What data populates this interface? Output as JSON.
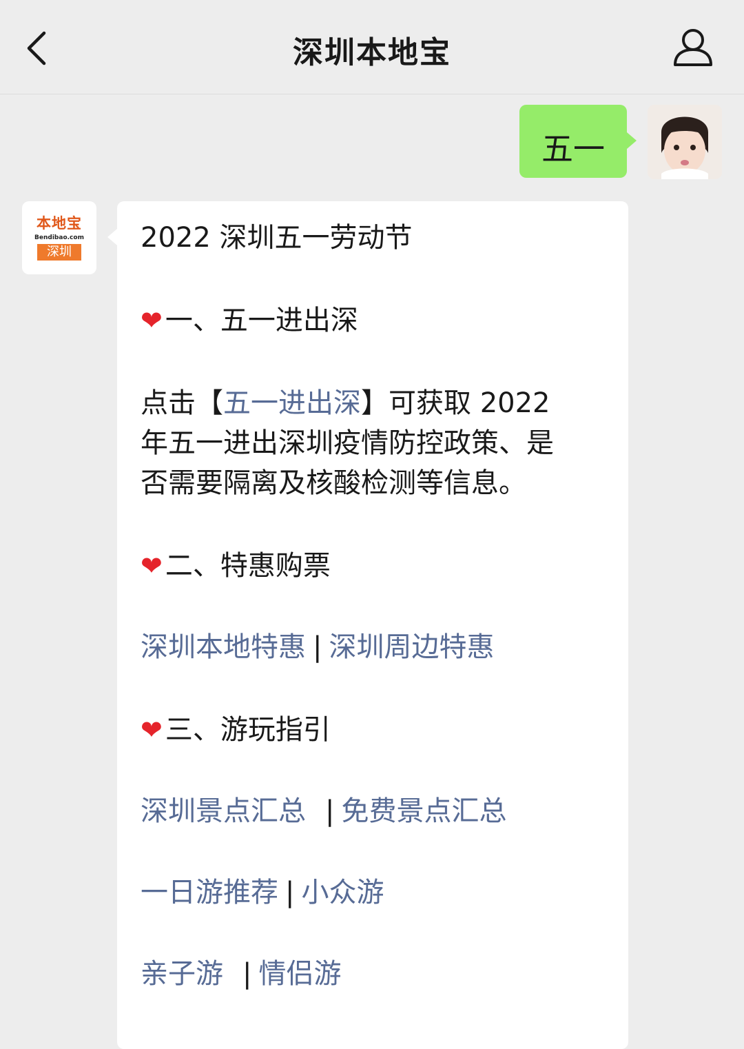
{
  "header": {
    "title": "深圳本地宝"
  },
  "outgoing": {
    "text": "五一"
  },
  "bot_avatar": {
    "line1": "本地宝",
    "line2": "Bendibao.com",
    "line3": "深圳"
  },
  "article": {
    "headline": "2022 深圳五一劳动节",
    "section1": "一、五一进出深",
    "p1_prefix": "点击",
    "p1_bracket_open": "【",
    "p1_link": "五一进出深",
    "p1_bracket_close": "】",
    "p1_rest1": "可获取 2022",
    "p1_line2": "年五一进出深圳疫情防控政策、是",
    "p1_line3": "否需要隔离及核酸检测等信息。",
    "section2": "二、特惠购票",
    "links2": [
      "深圳本地特惠",
      "深圳周边特惠"
    ],
    "section3": "三、游玩指引",
    "links3a": [
      "深圳景点汇总",
      "免费景点汇总"
    ],
    "links3b": [
      "一日游推荐",
      "小众游"
    ],
    "links3c": [
      "亲子游",
      "情侣游"
    ],
    "separator": "|",
    "heart": "❤"
  },
  "icons": [
    "back-chevron-icon",
    "profile-icon",
    "heart-icon"
  ],
  "colors": {
    "bg": "#ededed",
    "sent_bubble": "#95ec69",
    "link": "#576b95",
    "heart": "#e5242b"
  }
}
